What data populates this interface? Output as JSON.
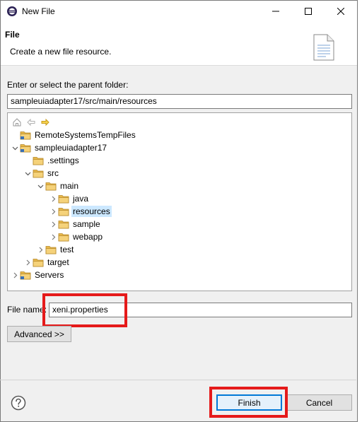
{
  "window": {
    "title": "New File"
  },
  "header": {
    "title": "File",
    "description": "Create a new file resource."
  },
  "parent_folder": {
    "label": "Enter or select the parent folder:",
    "value": "sampleuiadapter17/src/main/resources"
  },
  "tree": {
    "items": [
      {
        "label": "RemoteSystemsTempFiles",
        "expanded": null,
        "icon": "project-folder-icon"
      },
      {
        "label": "sampleuiadapter17",
        "expanded": true,
        "icon": "project-folder-icon"
      },
      {
        "label": ".settings",
        "expanded": null,
        "icon": "folder-icon"
      },
      {
        "label": "src",
        "expanded": true,
        "icon": "folder-icon"
      },
      {
        "label": "main",
        "expanded": true,
        "icon": "folder-icon"
      },
      {
        "label": "java",
        "expanded": false,
        "icon": "folder-icon"
      },
      {
        "label": "resources",
        "expanded": false,
        "icon": "folder-icon",
        "selected": true
      },
      {
        "label": "sample",
        "expanded": false,
        "icon": "folder-icon"
      },
      {
        "label": "webapp",
        "expanded": false,
        "icon": "folder-icon"
      },
      {
        "label": "test",
        "expanded": false,
        "icon": "folder-icon"
      },
      {
        "label": "target",
        "expanded": false,
        "icon": "folder-icon"
      },
      {
        "label": "Servers",
        "expanded": false,
        "icon": "project-folder-icon"
      }
    ]
  },
  "file_name": {
    "label": "File name:",
    "value": "xeni.properties"
  },
  "buttons": {
    "advanced": "Advanced >>",
    "finish": "Finish",
    "cancel": "Cancel"
  },
  "colors": {
    "highlight": "#e51a1a",
    "selection": "#cce8ff",
    "folder": "#e8b84a"
  }
}
